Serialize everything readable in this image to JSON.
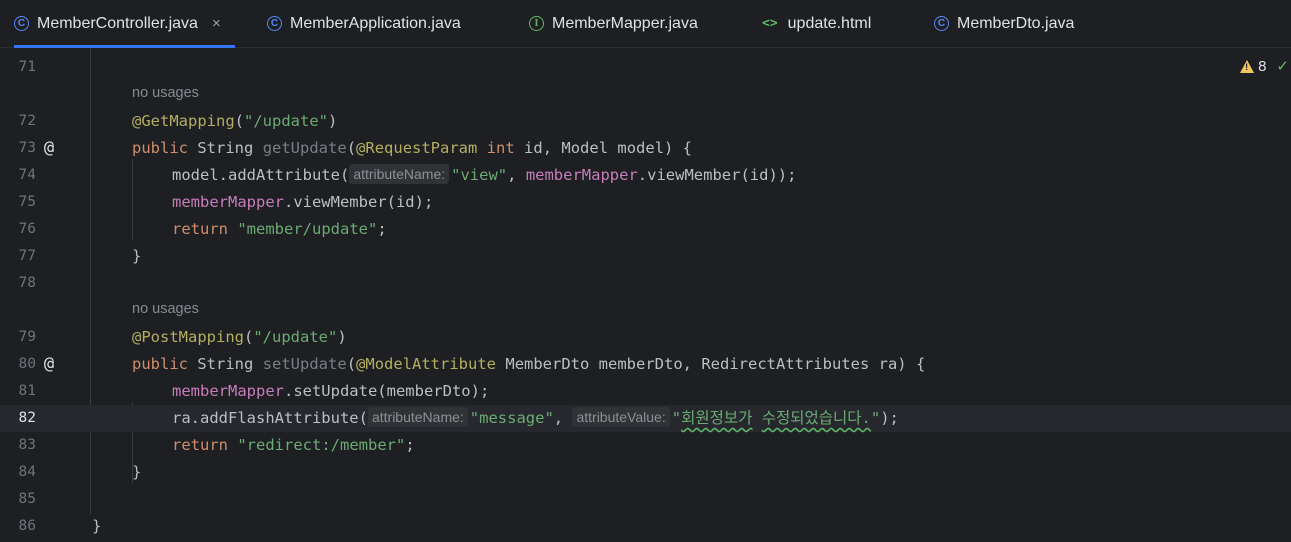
{
  "tabs": [
    {
      "label": "MemberController.java",
      "icon": "class-icon",
      "icon_glyph": "C",
      "active": true,
      "close": "×"
    },
    {
      "label": "MemberApplication.java",
      "icon": "class-icon",
      "icon_glyph": "C"
    },
    {
      "label": "MemberMapper.java",
      "icon": "interface-icon",
      "icon_glyph": "I"
    },
    {
      "label": "update.html",
      "icon": "html-icon",
      "icon_glyph": "<>"
    },
    {
      "label": "MemberDto.java",
      "icon": "class-icon",
      "icon_glyph": "C"
    }
  ],
  "inspections": {
    "warning_count": "8",
    "icon": "warning-icon",
    "check_icon": "check-icon"
  },
  "editor": {
    "current_line": "82",
    "lines": {
      "71": {
        "num": "71"
      },
      "usage1": {
        "text": "no usages"
      },
      "72": {
        "num": "72",
        "annotation": "@GetMapping",
        "open": "(",
        "path": "\"/update\"",
        "close": ")"
      },
      "73": {
        "num": "73",
        "gutter": "@",
        "kw_public": "public",
        "type": "String",
        "method": "getUpdate",
        "p1": "(",
        "ann": "@RequestParam",
        "kw_int": "int",
        "rest": "id, Model model) {"
      },
      "74": {
        "num": "74",
        "pre": "model.addAttribute(",
        "hint": "attributeName:",
        "str": "\"view\"",
        "comma": ", ",
        "field": "memberMapper",
        "post": ".viewMember(id));"
      },
      "75": {
        "num": "75",
        "field": "memberMapper",
        "post": ".viewMember(id);"
      },
      "76": {
        "num": "76",
        "kw": "return",
        "str": "\"member/update\"",
        "semi": ";"
      },
      "77": {
        "num": "77",
        "brace": "}"
      },
      "78": {
        "num": "78"
      },
      "usage2": {
        "text": "no usages"
      },
      "79": {
        "num": "79",
        "annotation": "@PostMapping",
        "open": "(",
        "path": "\"/update\"",
        "close": ")"
      },
      "80": {
        "num": "80",
        "gutter": "@",
        "kw_public": "public",
        "type": "String",
        "method": "setUpdate",
        "p1": "(",
        "ann": "@ModelAttribute",
        "rest": "MemberDto memberDto, RedirectAttributes ra) {"
      },
      "81": {
        "num": "81",
        "field": "memberMapper",
        "post": ".setUpdate(memberDto);"
      },
      "82": {
        "num": "82",
        "pre": "ra.addFlashAttribute(",
        "hint1": "attributeName:",
        "str1": "\"message\"",
        "comma": ", ",
        "hint2": "attributeValue:",
        "q_open": "\"",
        "ko1": "회원정보가",
        "sp": " ",
        "ko2": "수정되었습니다.",
        "q_close": "\"",
        "post": ");"
      },
      "83": {
        "num": "83",
        "kw": "return",
        "str": "\"redirect:/member\"",
        "semi": ";"
      },
      "84": {
        "num": "84",
        "brace": "}"
      },
      "85": {
        "num": "85"
      },
      "86": {
        "num": "86",
        "brace": "}"
      }
    }
  }
}
